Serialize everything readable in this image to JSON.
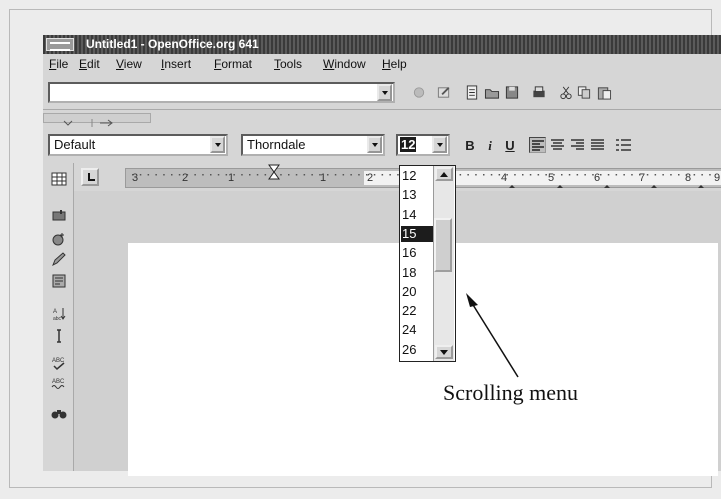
{
  "window": {
    "title": "Untitled1 - OpenOffice.org 641",
    "menu": [
      "File",
      "Edit",
      "View",
      "Insert",
      "Format",
      "Tools",
      "Window",
      "Help"
    ]
  },
  "format_bar": {
    "paragraph_style": "Default",
    "font_name": "Thorndale",
    "font_size": "12",
    "bold_label": "B",
    "italic_label": "i",
    "underline_label": "U"
  },
  "ruler": {
    "labels": [
      "3",
      "2",
      "1",
      "1",
      "2",
      "4",
      "5",
      "6",
      "7",
      "8",
      "9"
    ]
  },
  "size_list": {
    "items": [
      "12",
      "13",
      "14",
      "15",
      "16",
      "18",
      "20",
      "22",
      "24",
      "26"
    ],
    "selected": "15"
  },
  "annotation": {
    "text": "Scrolling menu"
  }
}
